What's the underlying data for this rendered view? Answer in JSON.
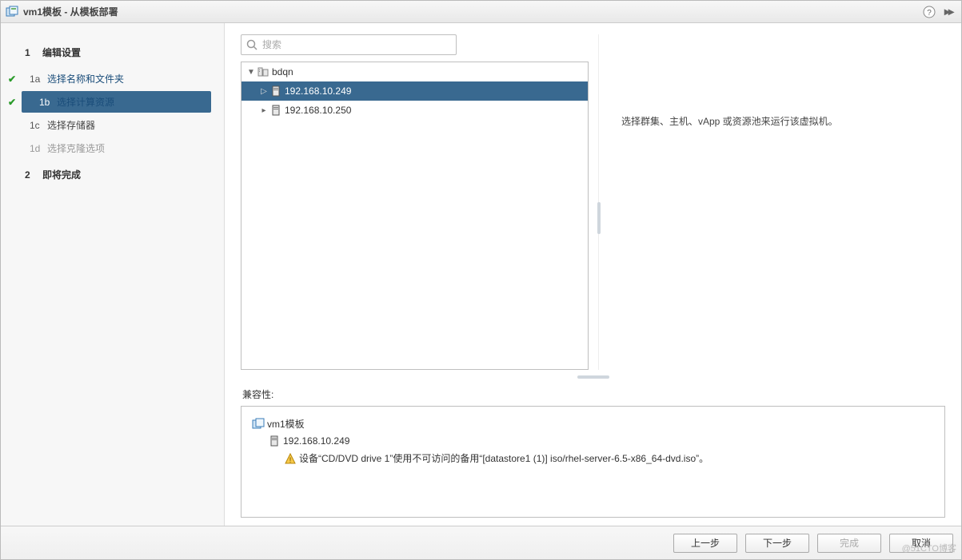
{
  "title": "vm1模板 - 从模板部署",
  "sidebar": {
    "steps": [
      {
        "num": "1",
        "label": "编辑设置",
        "kind": "major"
      },
      {
        "num": "1a",
        "label": "选择名称和文件夹",
        "kind": "sub",
        "state": "completed"
      },
      {
        "num": "1b",
        "label": "选择计算资源",
        "kind": "sub",
        "state": "selected"
      },
      {
        "num": "1c",
        "label": "选择存储器",
        "kind": "sub",
        "state": "normal"
      },
      {
        "num": "1d",
        "label": "选择克隆选项",
        "kind": "sub",
        "state": "disabled"
      },
      {
        "num": "2",
        "label": "即将完成",
        "kind": "major"
      }
    ]
  },
  "search": {
    "placeholder": "搜索"
  },
  "tree": {
    "root": {
      "label": "bdqn"
    },
    "hosts": [
      {
        "label": "192.168.10.249",
        "selected": true
      },
      {
        "label": "192.168.10.250",
        "selected": false
      }
    ]
  },
  "hint": "选择群集、主机、vApp 或资源池来运行该虚拟机。",
  "compat": {
    "label": "兼容性:",
    "vm_label": "vm1模板",
    "host_label": "192.168.10.249",
    "warning": "设备“CD/DVD drive 1”使用不可访问的备用“[datastore1 (1)] iso/rhel-server-6.5-x86_64-dvd.iso”。"
  },
  "footer": {
    "back": "上一步",
    "next": "下一步",
    "finish": "完成",
    "cancel": "取消"
  },
  "watermark": "@51CTO博客"
}
